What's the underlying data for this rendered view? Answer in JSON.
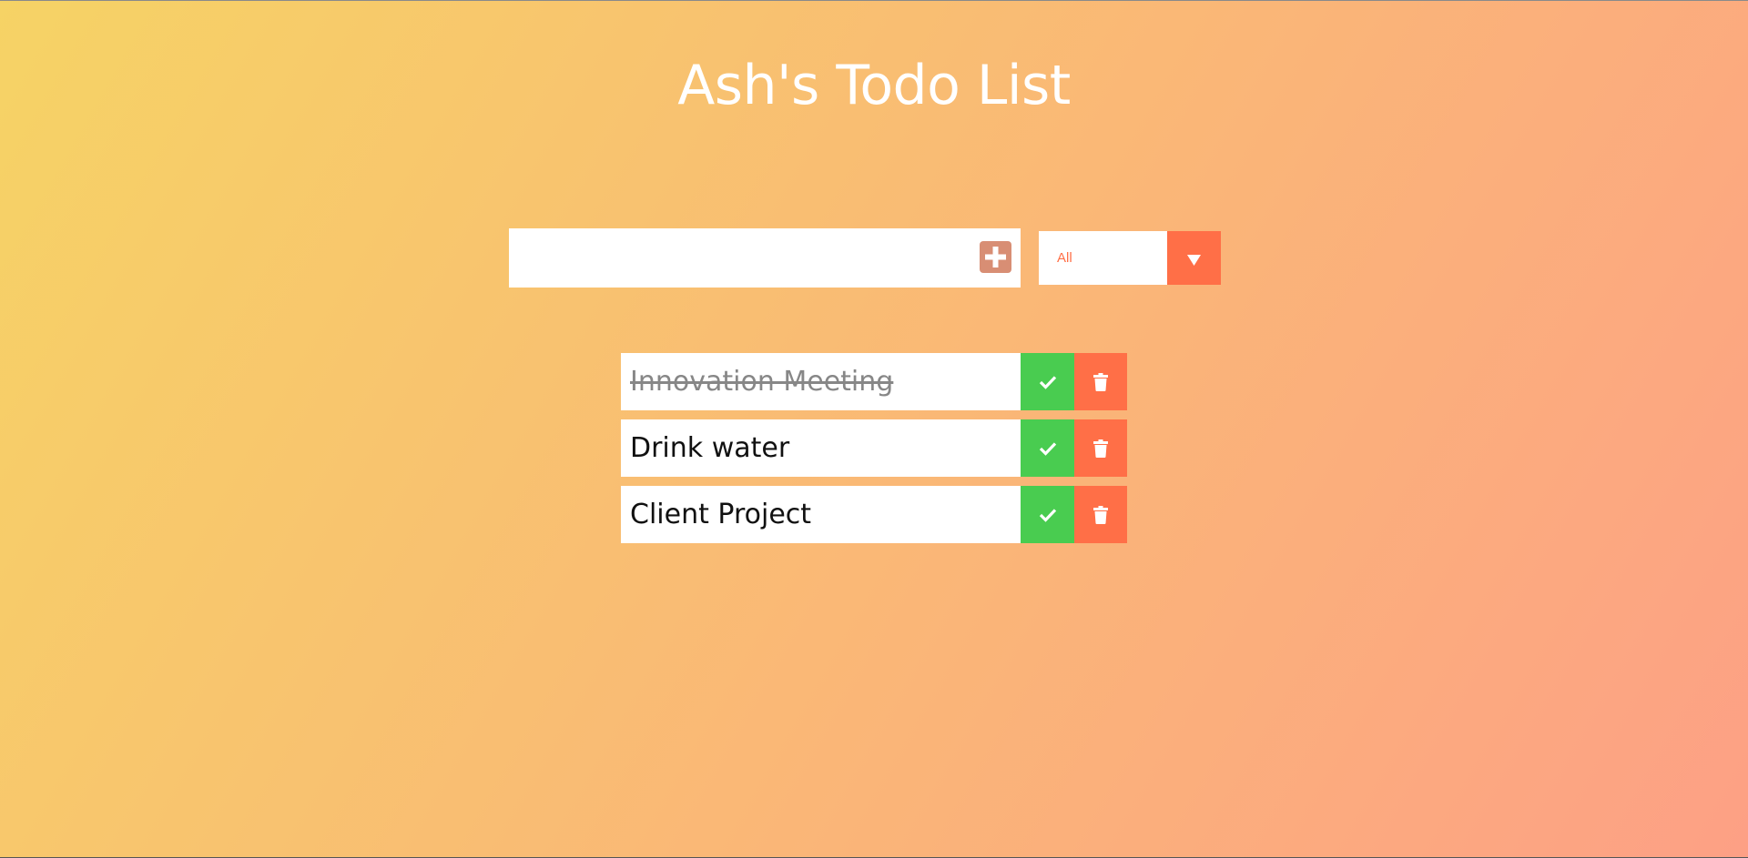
{
  "header": {
    "title": "Ash's Todo List"
  },
  "add_form": {
    "input_value": "",
    "button_icon": "plus-square-icon"
  },
  "filter": {
    "selected": "All",
    "icon": "caret-down-icon"
  },
  "todos": [
    {
      "text": "Innovation Meeting",
      "completed": true
    },
    {
      "text": "Drink water",
      "completed": false
    },
    {
      "text": "Client Project",
      "completed": false
    }
  ],
  "colors": {
    "gradient_start": "#f6d365",
    "gradient_end": "#fda085",
    "accent": "#ff6f47",
    "complete": "#49cc50",
    "add_button": "#d88e74"
  }
}
